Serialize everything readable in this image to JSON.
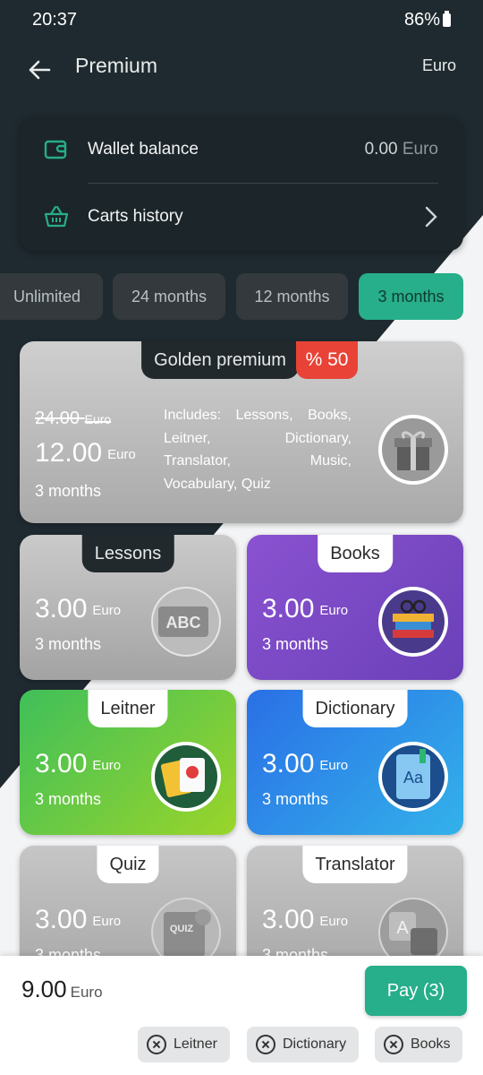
{
  "status": {
    "time": "20:37",
    "battery": "86%"
  },
  "appbar": {
    "title": "Premium",
    "currency": "Euro"
  },
  "wallet": {
    "balance_label": "Wallet balance",
    "balance_value": "0.00",
    "balance_unit": "Euro",
    "history_label": "Carts history"
  },
  "tabs": [
    {
      "label": "Unlimited",
      "active": false
    },
    {
      "label": "24 months",
      "active": false
    },
    {
      "label": "12 months",
      "active": false
    },
    {
      "label": "3 months",
      "active": true
    }
  ],
  "golden": {
    "tag": "Golden premium",
    "discount": "% 50",
    "old_price": "24.00",
    "old_unit": "Euro",
    "price": "12.00",
    "unit": "Euro",
    "duration": "3 months",
    "includes": "Includes: Lessons, Books, Leitner, Dictionary, Translator, Music, Vocabulary, Quiz",
    "icon": "gift-icon"
  },
  "products": [
    {
      "tag": "Lessons",
      "price": "3.00",
      "unit": "Euro",
      "duration": "3 months",
      "icon": "abc-board-icon"
    },
    {
      "tag": "Books",
      "price": "3.00",
      "unit": "Euro",
      "duration": "3 months",
      "icon": "books-stack-icon",
      "color": "#7d4cc4"
    },
    {
      "tag": "Leitner",
      "price": "3.00",
      "unit": "Euro",
      "duration": "3 months",
      "icon": "flashcards-icon",
      "color": "#5cc43a"
    },
    {
      "tag": "Dictionary",
      "price": "3.00",
      "unit": "Euro",
      "duration": "3 months",
      "icon": "dictionary-book-icon",
      "color": "#2f86e8"
    },
    {
      "tag": "Quiz",
      "price": "3.00",
      "unit": "Euro",
      "duration": "3 months",
      "icon": "quiz-icon"
    },
    {
      "tag": "Translator",
      "price": "3.00",
      "unit": "Euro",
      "duration": "3 months",
      "icon": "translate-icon"
    }
  ],
  "cart": {
    "total": "9.00",
    "unit": "Euro",
    "pay_label": "Pay (3)",
    "chips": [
      "Leitner",
      "Dictionary",
      "Books"
    ]
  },
  "colors": {
    "accent": "#27ae8a",
    "dark_bg": "#1f2a30",
    "discount": "#e84336"
  }
}
